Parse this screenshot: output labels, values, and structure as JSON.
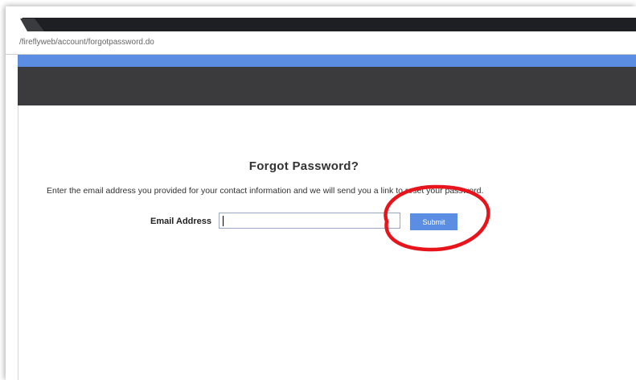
{
  "browser": {
    "url": "/fireflyweb/account/forgotpassword.do"
  },
  "page": {
    "title": "Forgot Password?",
    "instructions": "Enter the email address you provided for your contact information and we will send you a link to reset your password.",
    "email_label": "Email Address",
    "email_value": "",
    "submit_label": "Submit"
  },
  "annotation": {
    "color": "#e8141b"
  }
}
